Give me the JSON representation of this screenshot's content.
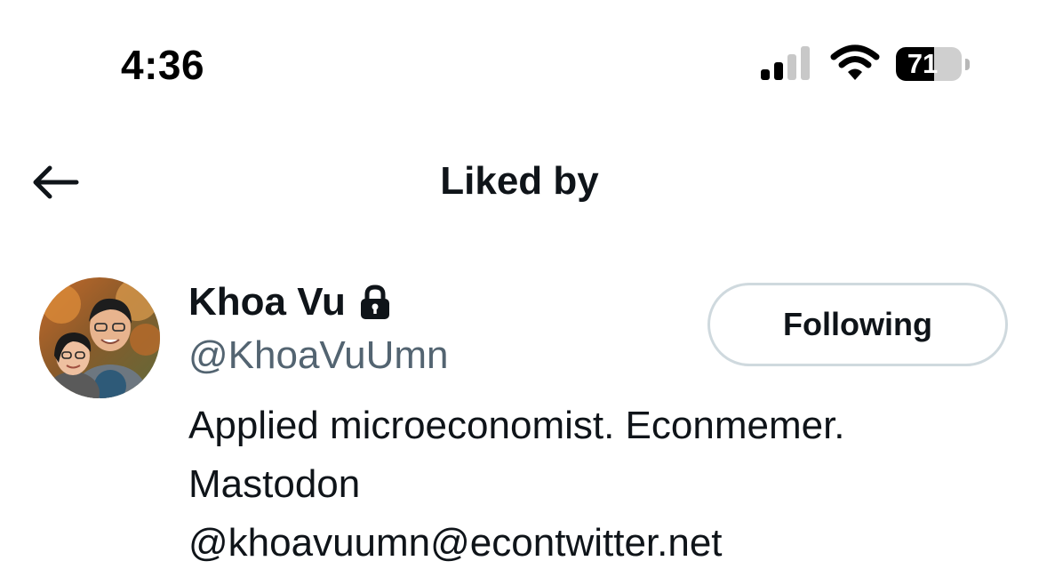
{
  "status_bar": {
    "time": "4:36",
    "battery_percent": 71,
    "battery_label": "71",
    "signal_bars_active": 2,
    "signal_bars_total": 4,
    "icons": [
      "signal-icon",
      "wifi-icon",
      "battery-icon"
    ]
  },
  "header": {
    "title": "Liked by",
    "back_icon": "arrow-left-icon"
  },
  "user": {
    "name": "Khoa Vu",
    "protected_icon": "lock-icon",
    "handle": "@KhoaVuUmn",
    "follow_button_label": "Following",
    "bio_lines": [
      "Applied microeconomist. Econmemer.",
      "Mastodon",
      "@khoavuumn@econtwitter.net"
    ]
  },
  "colors": {
    "text_primary": "#0f1419",
    "text_secondary": "#536471",
    "button_border": "#cfd9de"
  }
}
